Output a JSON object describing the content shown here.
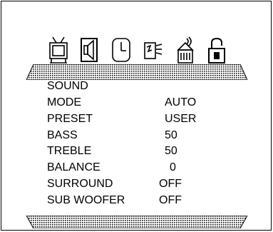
{
  "menu": {
    "title": "SOUND",
    "icons": [
      "picture-icon",
      "sound-icon",
      "clock-icon",
      "setup-icon",
      "channel-icon",
      "lock-icon"
    ],
    "selected_icon": "sound-icon",
    "items": [
      {
        "label": "MODE",
        "value": "AUTO"
      },
      {
        "label": "PRESET",
        "value": "USER"
      },
      {
        "label": "BASS",
        "value": "50"
      },
      {
        "label": "TREBLE",
        "value": "50"
      },
      {
        "label": "BALANCE",
        "value": "0"
      },
      {
        "label": "SURROUND",
        "value": "OFF"
      },
      {
        "label": "SUB WOOFER",
        "value": "OFF"
      }
    ]
  }
}
